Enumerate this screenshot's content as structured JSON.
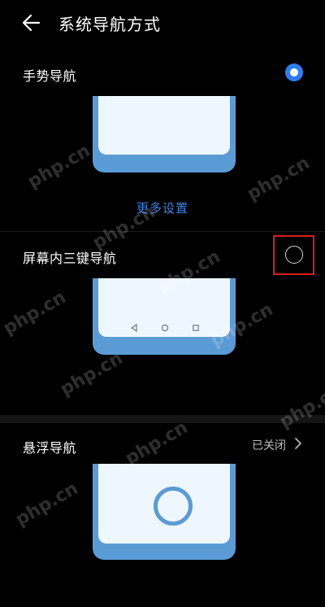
{
  "header": {
    "title": "系统导航方式",
    "back_icon": "arrow-left-icon"
  },
  "options": [
    {
      "label": "手势导航",
      "selected": true,
      "link": "更多设置"
    },
    {
      "label": "屏幕内三键导航",
      "selected": false,
      "highlighted": true,
      "buttons": [
        "back-triangle-icon",
        "home-circle-icon",
        "recent-square-icon"
      ]
    },
    {
      "label": "悬浮导航",
      "status": "已关闭"
    }
  ],
  "watermark": "php.cn",
  "colors": {
    "accent": "#2f7df6",
    "link": "#3a86e8",
    "phone_frame": "#5b9bd5",
    "phone_screen": "#eef7ff",
    "highlight": "#d81e1e"
  }
}
